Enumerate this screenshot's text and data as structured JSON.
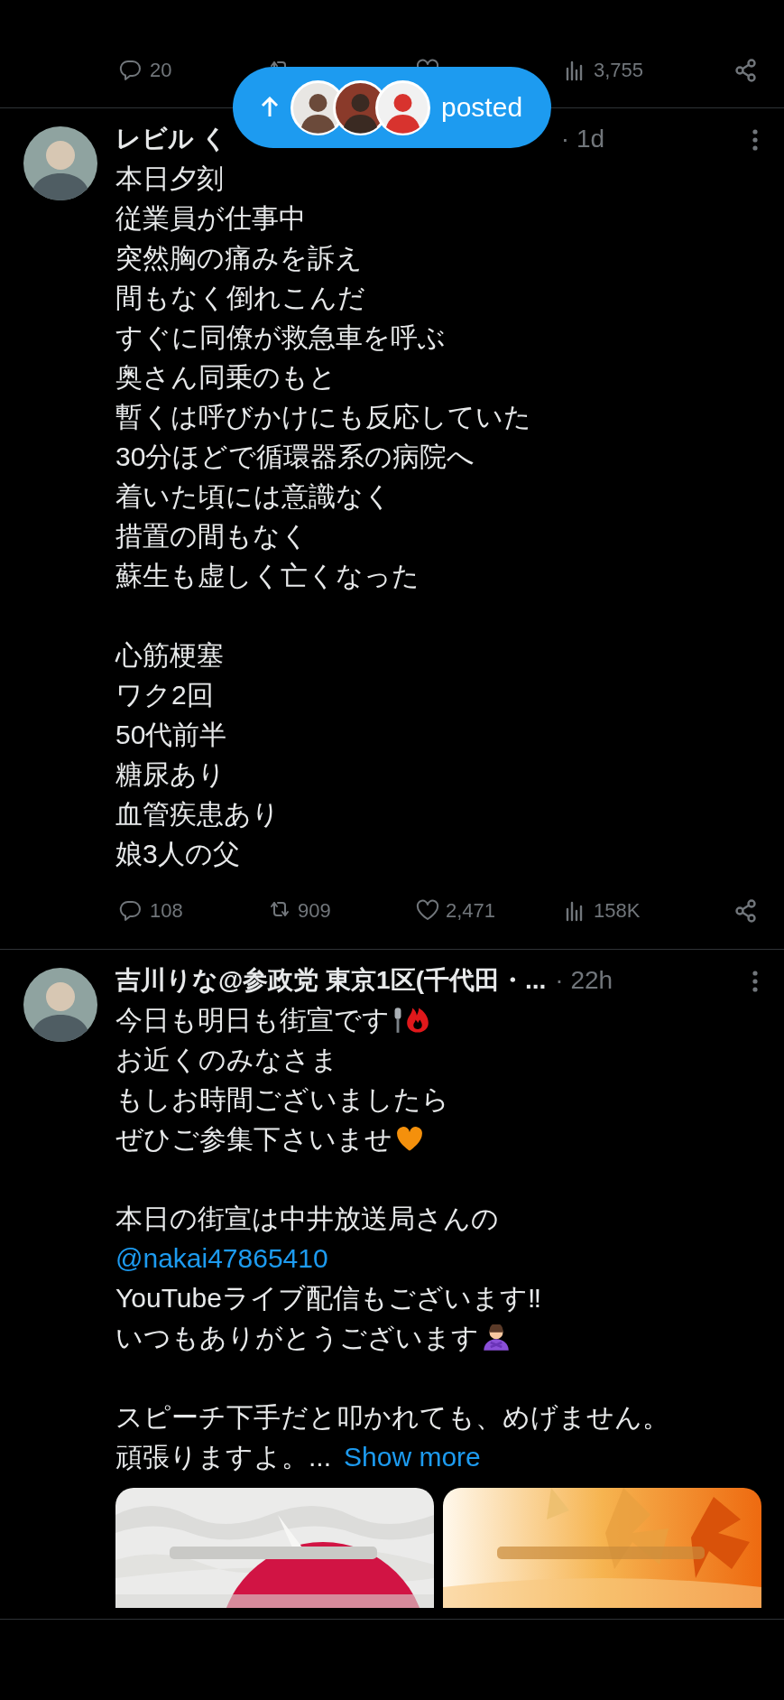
{
  "previous_tweet": {
    "actions": [
      {
        "kind": "reply",
        "count": "20"
      },
      {
        "kind": "retweet"
      },
      {
        "kind": "like"
      },
      {
        "kind": "views",
        "count": "3,755"
      },
      {
        "kind": "share"
      }
    ]
  },
  "new_posts_pill": {
    "label": "posted"
  },
  "tweets": [
    {
      "name": "レビル く",
      "time": "· 1d",
      "paragraphs": [
        [
          {
            "text": "本日夕刻"
          },
          {
            "text": "従業員が仕事中"
          },
          {
            "text": "突然胸の痛みを訴え"
          },
          {
            "text": "間もなく倒れこんだ"
          },
          {
            "text": "すぐに同僚が救急車を呼ぶ"
          },
          {
            "text": "奥さん同乗のもと"
          },
          {
            "text": "暫くは呼びかけにも反応していた"
          },
          {
            "text": "30分ほどで循環器系の病院へ"
          },
          {
            "text": "着いた頃には意識なく"
          },
          {
            "text": "措置の間もなく"
          },
          {
            "text": "蘇生も虚しく亡くなった"
          }
        ],
        [
          {
            "text": "心筋梗塞"
          },
          {
            "text": "ワク2回"
          },
          {
            "text": "50代前半"
          },
          {
            "text": "糖尿あり"
          },
          {
            "text": "血管疾患あり"
          },
          {
            "text": "娘3人の父"
          }
        ]
      ],
      "actions": [
        {
          "kind": "reply",
          "count": "108"
        },
        {
          "kind": "retweet",
          "count": "909"
        },
        {
          "kind": "like",
          "count": "2,471"
        },
        {
          "kind": "views",
          "count": "158K"
        },
        {
          "kind": "share"
        }
      ]
    },
    {
      "name": "吉川りな@参政党 東京1区(千代田・...",
      "time": "· 22h",
      "paragraphs": [
        [
          {
            "text": "今日も明日も街宣です",
            "emoji": [
              {
                "kind": "mic"
              },
              {
                "kind": "fire"
              }
            ]
          },
          {
            "text": "お近くのみなさま"
          },
          {
            "text": "もしお時間ございましたら"
          },
          {
            "text": "ぜひご参集下さいませ",
            "emoji": [
              {
                "kind": "orange-heart"
              }
            ]
          }
        ],
        [
          {
            "text": "本日の街宣は中井放送局さんの"
          },
          {
            "text": "@nakai47865410",
            "kind": "mention"
          },
          {
            "text": "YouTubeライブ配信もございます‼"
          },
          {
            "text": "いつもありがとうございます",
            "emoji": [
              {
                "kind": "bowing-person"
              }
            ]
          }
        ],
        [
          {
            "text": "スピーチ下手だと叩かれても、めげません。"
          },
          {
            "text": "頑張りますよ。...",
            "show_more": "Show more"
          }
        ]
      ],
      "media": [
        {
          "kind": "picture"
        },
        {
          "kind": "picture"
        }
      ]
    }
  ]
}
